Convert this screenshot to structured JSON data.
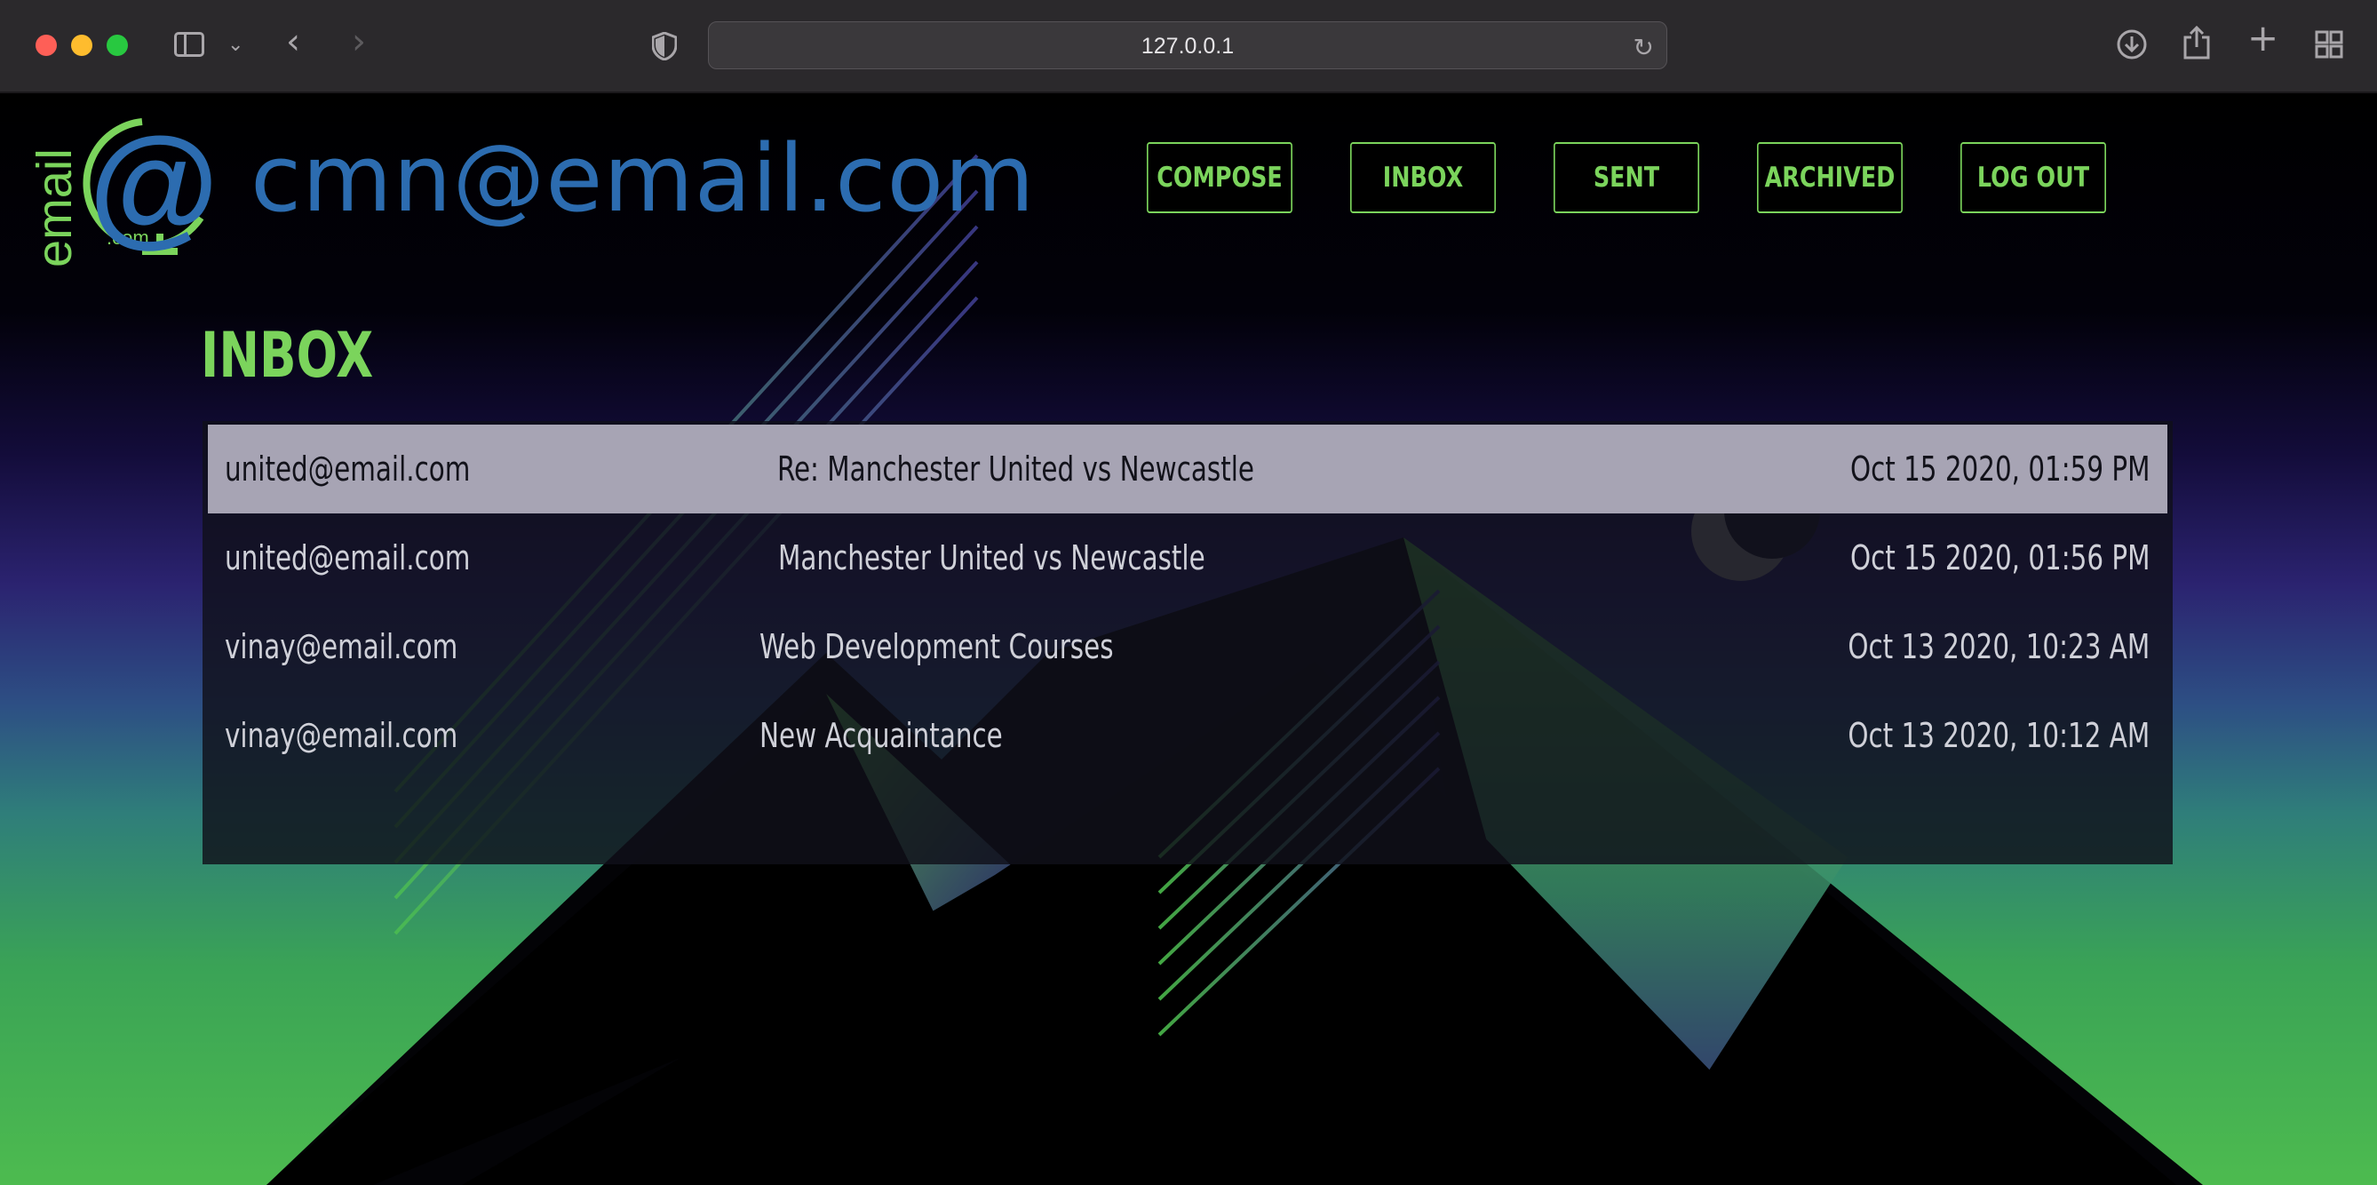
{
  "browser": {
    "address": "127.0.0.1"
  },
  "account": {
    "email": "cmn@email.com",
    "logo_text": "email",
    "logo_suffix": ".com",
    "logo_symbol": "@"
  },
  "nav": {
    "compose": "COMPOSE",
    "inbox": "INBOX",
    "sent": "SENT",
    "archived": "ARCHIVED",
    "logout": "LOG OUT"
  },
  "mailbox": {
    "title": "INBOX",
    "emails": [
      {
        "sender": "united@email.com",
        "subject": "Re: Manchester United vs Newcastle",
        "timestamp": "Oct 15 2020, 01:59 PM",
        "read": false
      },
      {
        "sender": "united@email.com",
        "subject": "Manchester United vs Newcastle",
        "timestamp": "Oct 15 2020, 01:56 PM",
        "read": true
      },
      {
        "sender": "vinay@email.com",
        "subject": "Web Development Courses",
        "timestamp": "Oct 13 2020, 10:23 AM",
        "read": true
      },
      {
        "sender": "vinay@email.com",
        "subject": "New Acquaintance",
        "timestamp": "Oct 13 2020, 10:12 AM",
        "read": true
      }
    ]
  },
  "colors": {
    "accent_green": "#7bd45c",
    "email_blue": "#2c6cb0",
    "unread_row": "#a7a4b4"
  }
}
